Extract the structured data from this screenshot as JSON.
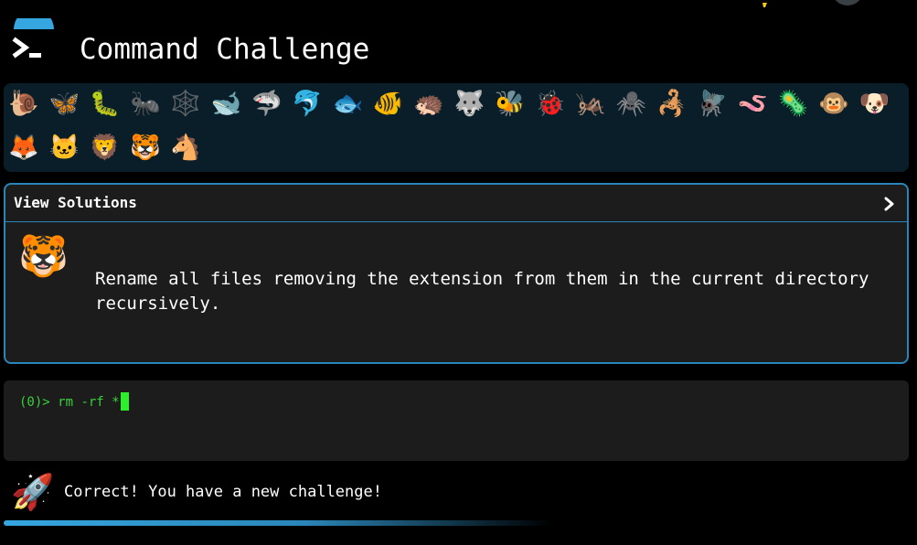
{
  "header": {
    "title": "Command Challenge",
    "logo_icon": "terminal-prompt-icon",
    "accent_color": "#35a6e0"
  },
  "animals": [
    {
      "name": "snail",
      "glyph": "🐌"
    },
    {
      "name": "butterfly",
      "glyph": "🦋"
    },
    {
      "name": "bug",
      "glyph": "🐛"
    },
    {
      "name": "ant",
      "glyph": "🐜"
    },
    {
      "name": "spider-web",
      "glyph": "🕸️"
    },
    {
      "name": "whale",
      "glyph": "🐋"
    },
    {
      "name": "shark",
      "glyph": "🦈"
    },
    {
      "name": "dolphin",
      "glyph": "🐬"
    },
    {
      "name": "fish",
      "glyph": "🐟"
    },
    {
      "name": "tropical-fish",
      "glyph": "🐠"
    },
    {
      "name": "hedgehog",
      "glyph": "🦔"
    },
    {
      "name": "wolf",
      "glyph": "🐺"
    },
    {
      "name": "bee",
      "glyph": "🐝"
    },
    {
      "name": "ladybug",
      "glyph": "🐞"
    },
    {
      "name": "cricket",
      "glyph": "🦗"
    },
    {
      "name": "spider",
      "glyph": "🕷️"
    },
    {
      "name": "scorpion",
      "glyph": "🦂"
    },
    {
      "name": "fly",
      "glyph": "🪰"
    },
    {
      "name": "worm",
      "glyph": "🪱"
    },
    {
      "name": "microbe",
      "glyph": "🦠"
    },
    {
      "name": "monkey",
      "glyph": "🐵"
    },
    {
      "name": "dog",
      "glyph": "🐶"
    },
    {
      "name": "fox",
      "glyph": "🦊"
    },
    {
      "name": "cat",
      "glyph": "🐱"
    },
    {
      "name": "lion",
      "glyph": "🦁"
    },
    {
      "name": "tiger",
      "glyph": "🐯"
    },
    {
      "name": "horse",
      "glyph": "🐴"
    }
  ],
  "solutions": {
    "title": "View Solutions",
    "chevron_icon": "chevron-right-icon",
    "avatar_glyph": "🐯",
    "avatar_icon": "tiger-icon",
    "challenge_text": "Rename all files removing the extension from them in the current directory recursively."
  },
  "terminal": {
    "prompt": "(0)> ",
    "command": "rm -rf *"
  },
  "status": {
    "rocket_glyph": "🚀",
    "rocket_icon": "rocket-icon",
    "message": "Correct! You have a new challenge!"
  }
}
